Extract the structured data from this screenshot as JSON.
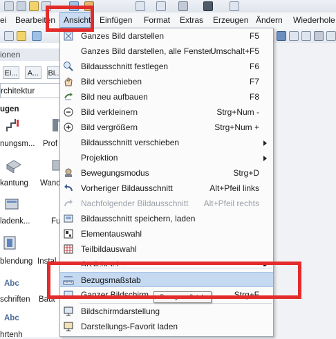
{
  "menubar": {
    "items": [
      {
        "label": "ei"
      },
      {
        "label": "Bearbeiten"
      },
      {
        "label": "Ansicht"
      },
      {
        "label": "Einfügen"
      },
      {
        "label": "Format"
      },
      {
        "label": "Extras"
      },
      {
        "label": "Erzeugen"
      },
      {
        "label": "Ändern"
      },
      {
        "label": "Wiederhole"
      }
    ]
  },
  "left_panel": {
    "header": "ionen",
    "tabs": [
      "Ei...",
      "A...",
      "Bi..."
    ],
    "combo_value": "rchitektur",
    "section": "ugen",
    "items": [
      {
        "label": "nungsm..."
      },
      {
        "label": "Prof"
      },
      {
        "label": "kantung"
      },
      {
        "label": "Wand"
      },
      {
        "label": "ladenk..."
      },
      {
        "label": "Fu"
      },
      {
        "label": "blendung"
      },
      {
        "label": "Instal"
      },
      {
        "label": "schriften"
      },
      {
        "label": "Baut"
      },
      {
        "label": "hrtenh"
      }
    ],
    "abc": "Abc"
  },
  "menu": {
    "items": [
      {
        "label": "Ganzes Bild darstellen",
        "shortcut": "F5",
        "icon": "fit-view-icon"
      },
      {
        "label": "Ganzes Bild darstellen, alle Fenster",
        "shortcut": "Umschalt+F5",
        "icon": ""
      },
      {
        "label": "Bildausschnitt festlegen",
        "shortcut": "F6",
        "icon": "zoom-window-icon"
      },
      {
        "label": "Bild verschieben",
        "shortcut": "F7",
        "icon": "pan-hand-icon"
      },
      {
        "label": "Bild neu aufbauen",
        "shortcut": "F8",
        "icon": "redraw-icon"
      },
      {
        "label": "Bild verkleinern",
        "shortcut": "Strg+Num -",
        "icon": "zoom-out-icon"
      },
      {
        "label": "Bild vergrößern",
        "shortcut": "Strg+Num +",
        "icon": "zoom-in-icon"
      },
      {
        "label": "Bildausschnitt verschieben",
        "shortcut": "",
        "icon": "",
        "submenu": true
      },
      {
        "label": "Projektion",
        "shortcut": "",
        "icon": "",
        "submenu": true
      },
      {
        "label": "Bewegungsmodus",
        "shortcut": "Strg+D",
        "icon": "navigation-mode-icon"
      },
      {
        "label": "Vorheriger Bildausschnitt",
        "shortcut": "Alt+Pfeil links",
        "icon": "undo-view-icon"
      },
      {
        "label": "Nachfolgender Bildausschnitt",
        "shortcut": "Alt+Pfeil rechts",
        "icon": "redo-view-icon",
        "disabled": true
      },
      {
        "label": "Bildausschnitt speichern, laden",
        "shortcut": "",
        "icon": "save-view-icon"
      },
      {
        "label": "Elementauswahl",
        "shortcut": "",
        "icon": "element-select-icon"
      },
      {
        "label": "Teilbildauswahl",
        "shortcut": "",
        "icon": "drawing-select-icon"
      },
      {
        "label": "Ansichtsel...",
        "shortcut": "",
        "icon": "",
        "submenu": true
      },
      {
        "label": "Bezugsmaßstab",
        "shortcut": "",
        "icon": "reference-scale-icon",
        "highlighted": true
      },
      {
        "label": "Ganzer Bildschirm",
        "shortcut": "Strg+F",
        "icon": "fullscreen-icon"
      },
      {
        "label": "Bildschirmdarstellung",
        "shortcut": "",
        "icon": "screen-display-icon"
      },
      {
        "label": "Darstellungs-Favorit laden",
        "shortcut": "",
        "icon": "favorite-display-icon"
      }
    ]
  },
  "tooltip": "Bezugsmaßstab",
  "colors": {
    "highlight": "#c5d9f1",
    "annotation": "#e32b2b",
    "menubar_active": "#c9dcf3"
  }
}
